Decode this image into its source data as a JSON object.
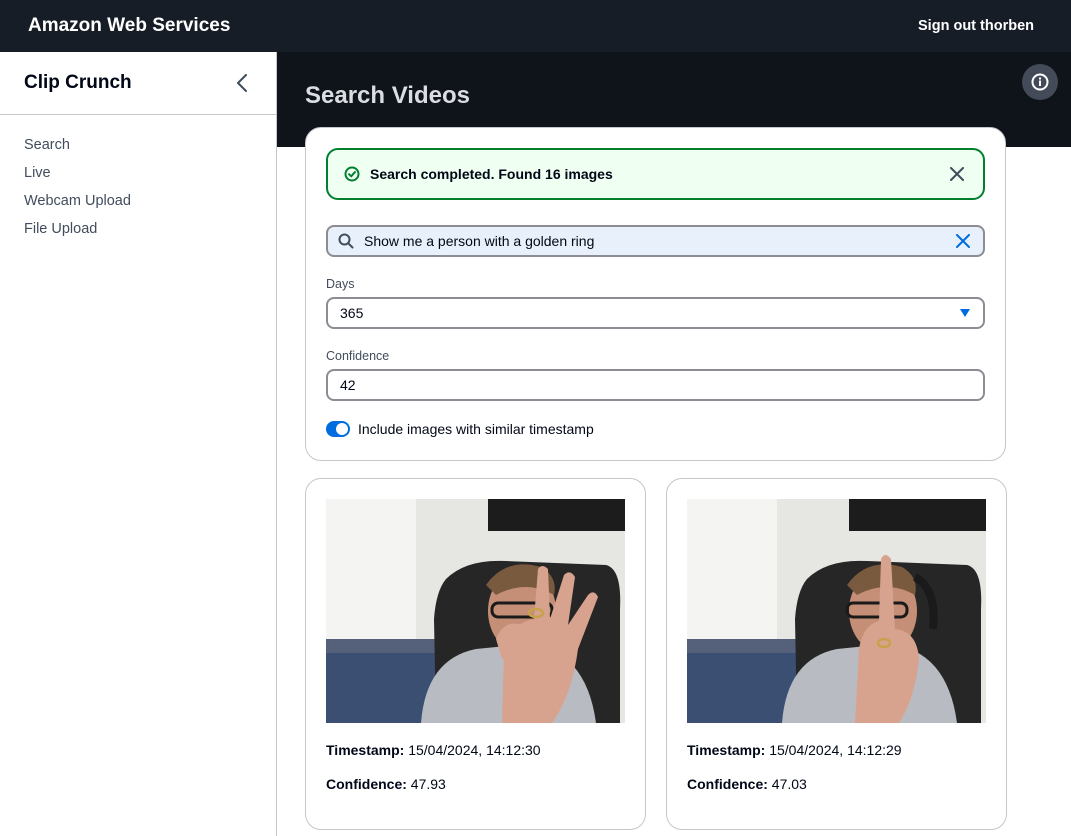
{
  "topbar": {
    "brand": "Amazon Web Services",
    "signout": "Sign out thorben"
  },
  "sidebar": {
    "title": "Clip Crunch",
    "items": [
      {
        "label": "Search"
      },
      {
        "label": "Live"
      },
      {
        "label": "Webcam Upload"
      },
      {
        "label": "File Upload"
      }
    ]
  },
  "page": {
    "title": "Search Videos"
  },
  "alert": {
    "text": "Search completed. Found 16 images",
    "status_color": "#00802f"
  },
  "search": {
    "value": "Show me a person with a golden ring"
  },
  "days": {
    "label": "Days",
    "value": "365"
  },
  "confidence": {
    "label": "Confidence",
    "value": "42"
  },
  "toggle": {
    "label": "Include images with similar timestamp",
    "checked": true
  },
  "results": [
    {
      "timestamp_label": "Timestamp:",
      "timestamp": "15/04/2024, 14:12:30",
      "confidence_label": "Confidence:",
      "confidence": "47.93"
    },
    {
      "timestamp_label": "Timestamp:",
      "timestamp": "15/04/2024, 14:12:29",
      "confidence_label": "Confidence:",
      "confidence": "47.03"
    }
  ],
  "colors": {
    "header_bg": "#161d26",
    "hero_bg": "#0f141a",
    "accent": "#006ce0"
  }
}
